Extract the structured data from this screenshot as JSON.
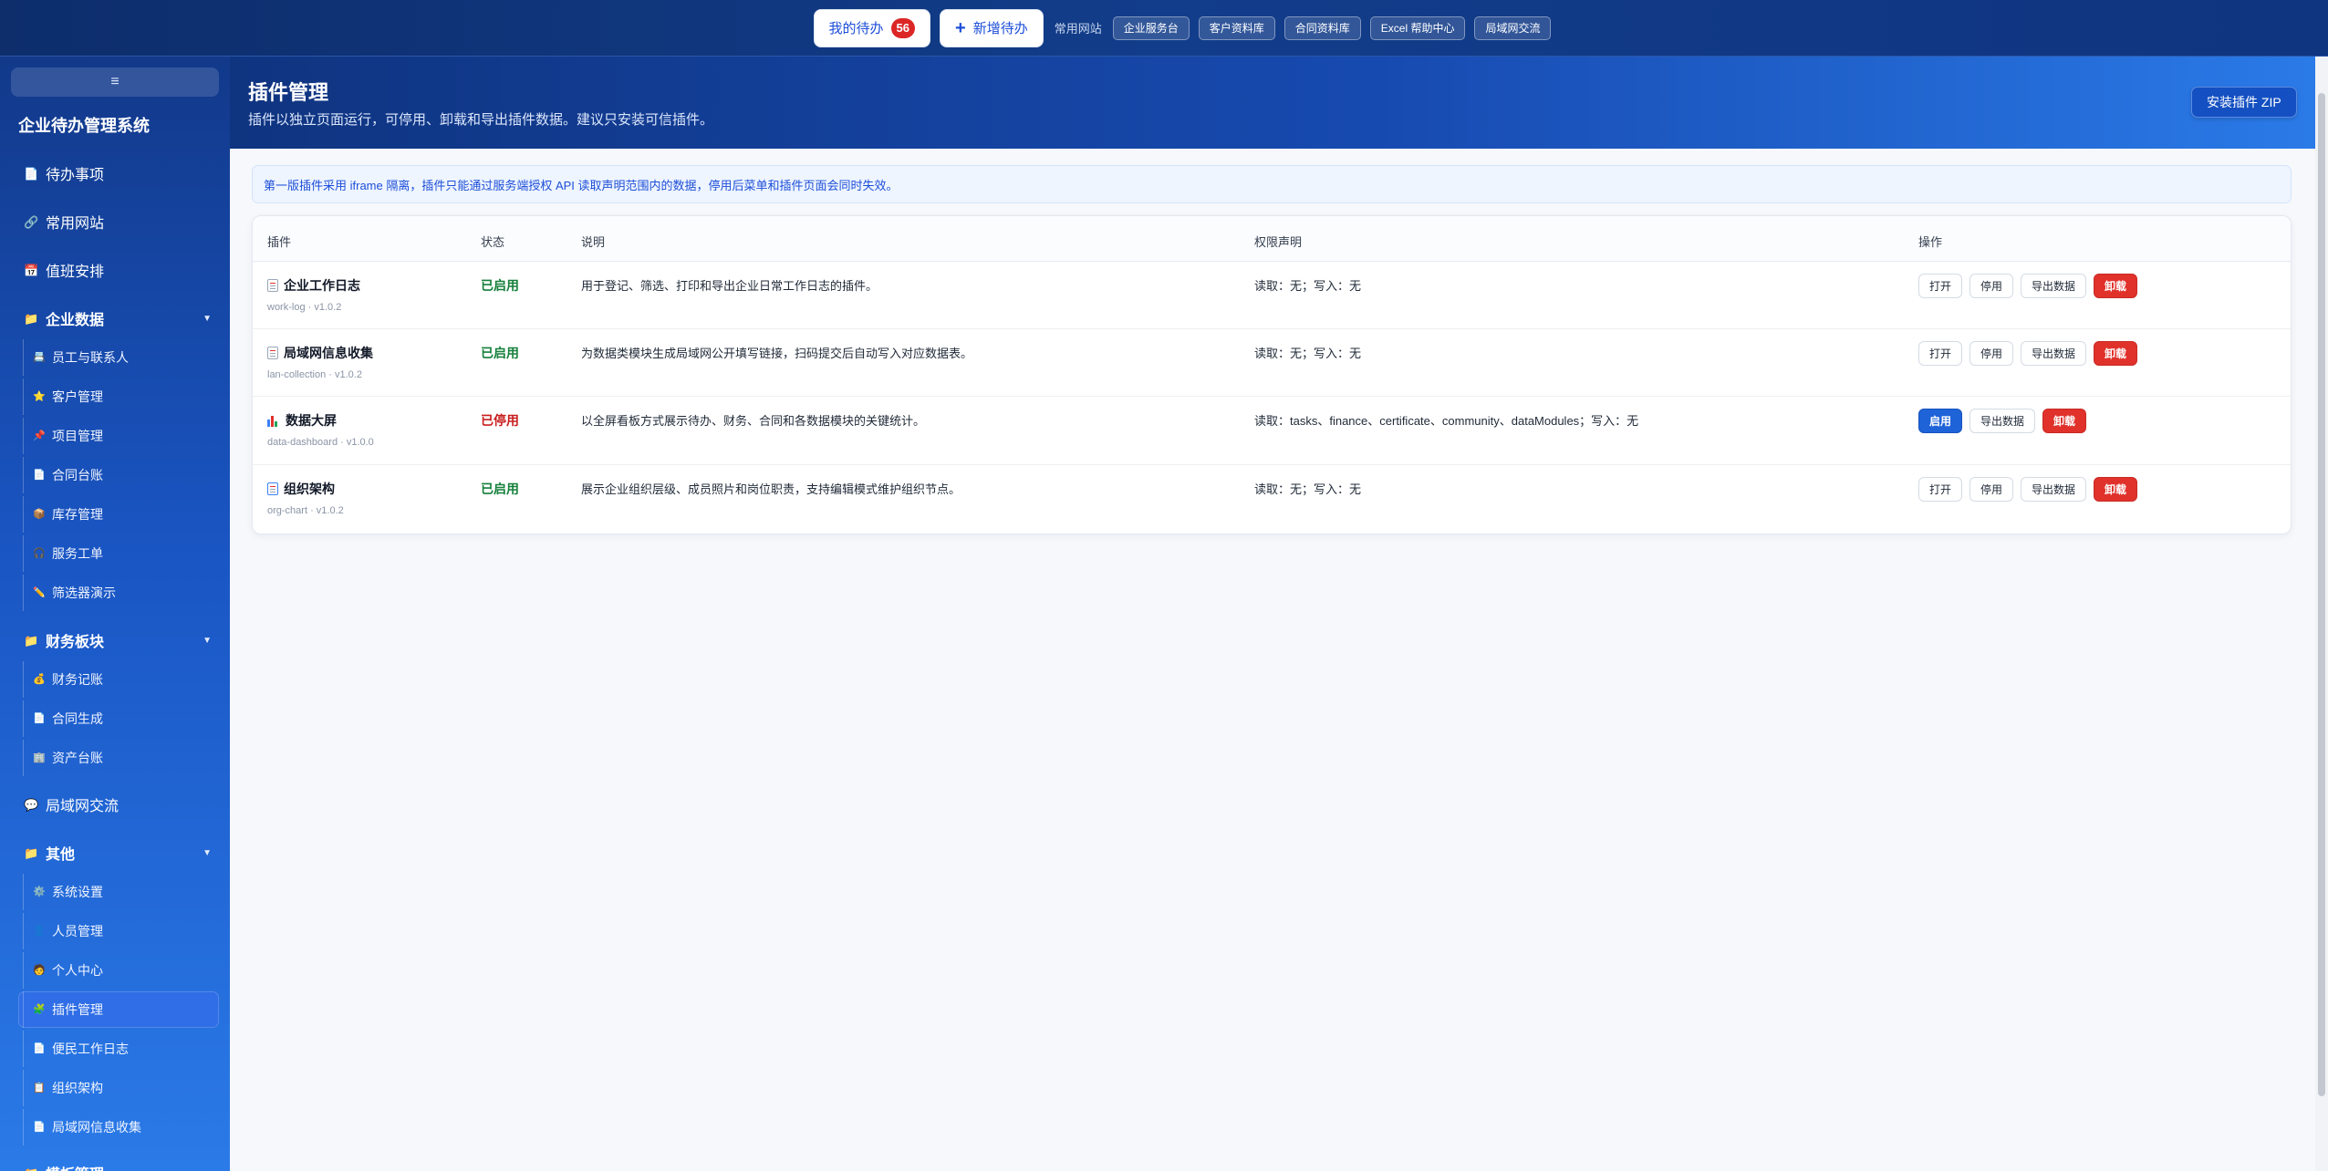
{
  "topbar": {
    "my_todo_label": "我的待办",
    "my_todo_count": "56",
    "new_todo_label": "新增待办",
    "common_sites_label": "常用网站",
    "links": [
      "企业服务台",
      "客户资料库",
      "合同资料库",
      "Excel 帮助中心",
      "局域网交流"
    ]
  },
  "sidebar": {
    "toggle_icon": "≡",
    "app_title": "企业待办管理系统",
    "top_items": [
      {
        "label": "待办事项",
        "icon": "document-icon"
      },
      {
        "label": "常用网站",
        "icon": "link-icon"
      },
      {
        "label": "值班安排",
        "icon": "calendar-icon"
      }
    ],
    "groups": [
      {
        "label": "企业数据",
        "items": [
          {
            "label": "员工与联系人",
            "icon": "contacts-icon"
          },
          {
            "label": "客户管理",
            "icon": "star-icon"
          },
          {
            "label": "项目管理",
            "icon": "pin-icon"
          },
          {
            "label": "合同台账",
            "icon": "document-icon"
          },
          {
            "label": "库存管理",
            "icon": "box-icon"
          },
          {
            "label": "服务工单",
            "icon": "headset-icon"
          },
          {
            "label": "筛选器演示",
            "icon": "pencil-icon"
          }
        ]
      },
      {
        "label": "财务板块",
        "items": [
          {
            "label": "财务记账",
            "icon": "money-bag-icon"
          },
          {
            "label": "合同生成",
            "icon": "document-icon"
          },
          {
            "label": "资产台账",
            "icon": "building-icon"
          }
        ]
      },
      {
        "label": "局域网交流",
        "icon": "chat-icon"
      },
      {
        "label": "其他",
        "items": [
          {
            "label": "系统设置",
            "icon": "gear-icon"
          },
          {
            "label": "人员管理",
            "icon": "user-icon"
          },
          {
            "label": "个人中心",
            "icon": "user-icon"
          },
          {
            "label": "插件管理",
            "icon": "puzzle-icon"
          },
          {
            "label": "便民工作日志",
            "icon": "document-icon"
          },
          {
            "label": "组织架构",
            "icon": "org-icon"
          },
          {
            "label": "局域网信息收集",
            "icon": "document-icon"
          }
        ]
      },
      {
        "label": "模板管理",
        "icon": "folder-icon"
      }
    ]
  },
  "header": {
    "title": "插件管理",
    "subtitle": "插件以独立页面运行，可停用、卸载和导出插件数据。建议只安装可信插件。",
    "install_button": "安装插件 ZIP"
  },
  "notice": "第一版插件采用 iframe 隔离，插件只能通过服务端授权 API 读取声明范围内的数据，停用后菜单和插件页面会同时失效。",
  "table": {
    "columns": [
      "插件",
      "状态",
      "说明",
      "权限声明",
      "操作"
    ],
    "rows": [
      {
        "name": "企业工作日志",
        "meta": "work-log · v1.0.2",
        "icon": "document-icon",
        "status": "已启用",
        "status_color": "#16803c",
        "description": "用于登记、筛选、打印和导出企业日常工作日志的插件。",
        "permissions": "读取：无；写入：无",
        "actions": [
          "打开",
          "停用",
          "导出数据",
          "卸载"
        ]
      },
      {
        "name": "局域网信息收集",
        "meta": "lan-collection · v1.0.2",
        "icon": "document-icon",
        "status": "已启用",
        "status_color": "#16803c",
        "description": "为数据类模块生成局域网公开填写链接，扫码提交后自动写入对应数据表。",
        "permissions": "读取：无；写入：无",
        "actions": [
          "打开",
          "停用",
          "导出数据",
          "卸载"
        ]
      },
      {
        "name": "数据大屏",
        "meta": "data-dashboard · v1.0.0",
        "icon": "bar-chart-icon",
        "status": "已停用",
        "status_color": "#c81e1e",
        "description": "以全屏看板方式展示待办、财务、合同和各数据模块的关键统计。",
        "permissions": "读取：tasks、finance、certificate、community、dataModules；写入：无",
        "actions": [
          "启用",
          "导出数据",
          "卸载"
        ]
      },
      {
        "name": "组织架构",
        "meta": "org-chart · v1.0.2",
        "icon": "org-icon",
        "status": "已启用",
        "status_color": "#16803c",
        "description": "展示企业组织层级、成员照片和岗位职责，支持编辑模式维护组织节点。",
        "permissions": "读取：无；写入：无",
        "actions": [
          "打开",
          "停用",
          "导出数据",
          "卸载"
        ]
      }
    ]
  },
  "colors": {
    "brand": "#1d4ed8",
    "danger": "#e0322b",
    "enabled": "#16803c",
    "disabled": "#c81e1e"
  }
}
